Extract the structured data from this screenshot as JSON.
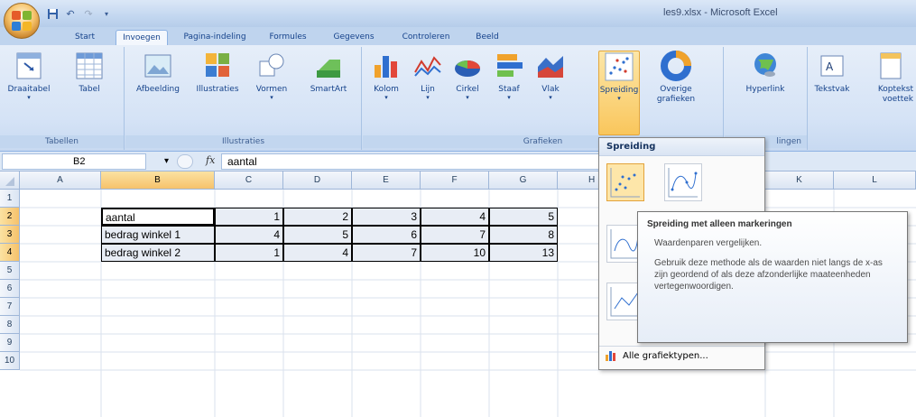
{
  "window": {
    "title": "les9.xlsx - Microsoft Excel"
  },
  "tabs": [
    "Start",
    "Invoegen",
    "Pagina-indeling",
    "Formules",
    "Gegevens",
    "Controleren",
    "Beeld"
  ],
  "active_tab": "Invoegen",
  "ribbon": {
    "groups": {
      "tabellen": {
        "label": "Tabellen",
        "buttons": [
          "Draaitabel",
          "Tabel"
        ]
      },
      "illustraties": {
        "label": "Illustraties",
        "buttons": [
          "Afbeelding",
          "Illustraties",
          "Vormen",
          "SmartArt"
        ]
      },
      "grafieken": {
        "label": "Grafieken",
        "buttons": [
          "Kolom",
          "Lijn",
          "Cirkel",
          "Staaf",
          "Vlak",
          "Spreiding",
          "Overige grafieken"
        ]
      },
      "koppelingen": {
        "label": "lingen",
        "buttons": [
          "Hyperlink"
        ]
      },
      "tekst": {
        "buttons": [
          "Tekstvak",
          "Koptekst voettek"
        ]
      }
    }
  },
  "formula_bar": {
    "name_box": "B2",
    "fx": "fx",
    "value": "aantal"
  },
  "columns": [
    "A",
    "B",
    "C",
    "D",
    "E",
    "F",
    "G",
    "H",
    "K",
    "L"
  ],
  "rows": [
    "1",
    "2",
    "3",
    "4",
    "5",
    "6",
    "7",
    "8",
    "9",
    "10"
  ],
  "sheet": {
    "rows": [
      {
        "label": "aantal",
        "values": [
          "1",
          "2",
          "3",
          "4",
          "5"
        ]
      },
      {
        "label": "bedrag winkel 1",
        "values": [
          "4",
          "5",
          "6",
          "7",
          "8"
        ]
      },
      {
        "label": "bedrag winkel 2",
        "values": [
          "1",
          "4",
          "7",
          "10",
          "13"
        ]
      }
    ]
  },
  "dropdown": {
    "header": "Spreiding",
    "all_types": "Alle grafiektypen..."
  },
  "tooltip": {
    "title": "Spreiding met alleen markeringen",
    "line1": "Waardenparen vergelijken.",
    "body": "Gebruik deze methode als de waarden niet langs de x-as zijn geordend of als deze afzonderlijke maateenheden vertegenwoordigen."
  }
}
